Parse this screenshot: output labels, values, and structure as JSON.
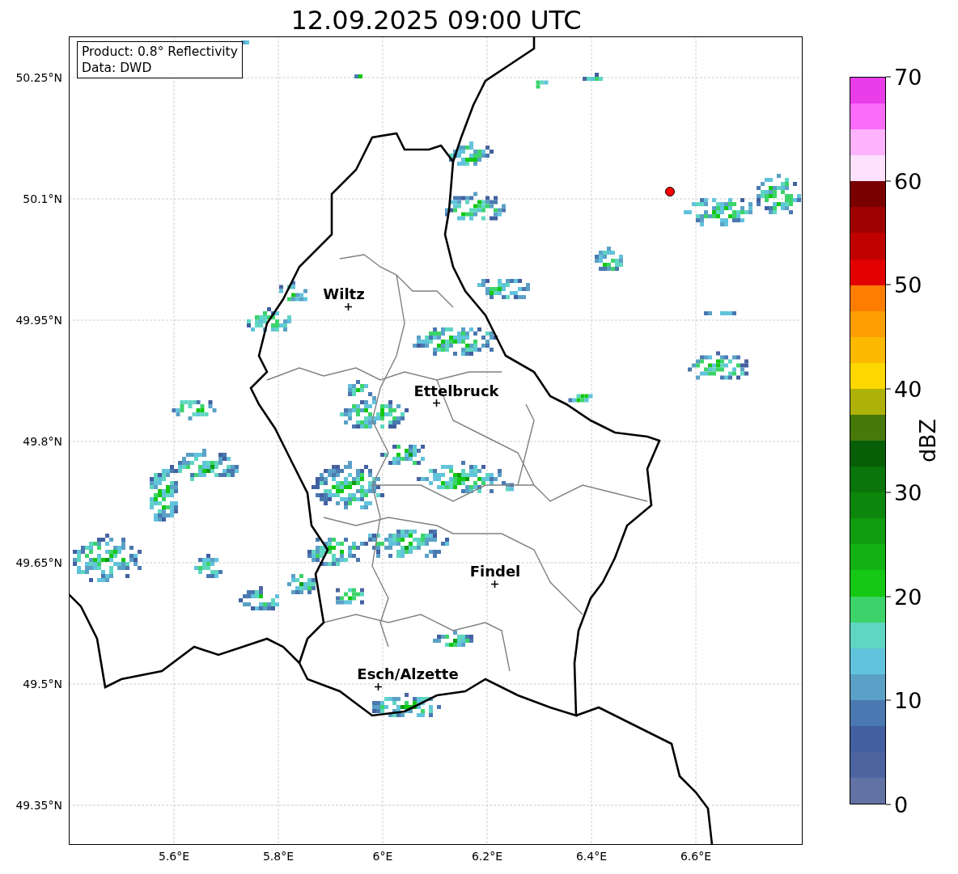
{
  "title": "12.09.2025 09:00 UTC",
  "info_box": {
    "lines": [
      "Product: 0.8° Reflectivity",
      "Data: DWD"
    ]
  },
  "map": {
    "lat_labels": [
      "50.25°N",
      "50.1°N",
      "49.95°N",
      "49.8°N",
      "49.65°N",
      "49.5°N",
      "49.35°N"
    ],
    "lon_labels": [
      "5.6°E",
      "5.8°E",
      "6°E",
      "6.2°E",
      "6.4°E",
      "6.6°E"
    ],
    "places": [
      {
        "name": "Wiltz"
      },
      {
        "name": "Ettelbruck"
      },
      {
        "name": "Findel"
      },
      {
        "name": "Esch/Alzette"
      }
    ]
  },
  "colorbar": {
    "label": "dBZ",
    "ticks": [
      "70",
      "60",
      "50",
      "40",
      "30",
      "20",
      "10",
      "0"
    ],
    "bins": [
      {
        "color": "#e83de8"
      },
      {
        "color": "#fb6cfb"
      },
      {
        "color": "#fdb4fd"
      },
      {
        "color": "#fde1fd"
      },
      {
        "color": "#7a0000"
      },
      {
        "color": "#9f0000"
      },
      {
        "color": "#c10000"
      },
      {
        "color": "#e30000"
      },
      {
        "color": "#ff7d00"
      },
      {
        "color": "#ff9e00"
      },
      {
        "color": "#fdb900"
      },
      {
        "color": "#fdd700"
      },
      {
        "color": "#aeb108"
      },
      {
        "color": "#46780a"
      },
      {
        "color": "#075e07"
      },
      {
        "color": "#0a750a"
      },
      {
        "color": "#0c870c"
      },
      {
        "color": "#0f9c0f"
      },
      {
        "color": "#12b212"
      },
      {
        "color": "#14c814"
      },
      {
        "color": "#3cd46a"
      },
      {
        "color": "#5fd6c2"
      },
      {
        "color": "#62c3dc"
      },
      {
        "color": "#5ba0c6"
      },
      {
        "color": "#4a78b0"
      },
      {
        "color": "#425fa0"
      },
      {
        "color": "#4d64a0"
      },
      {
        "color": "#6272a5"
      }
    ]
  }
}
